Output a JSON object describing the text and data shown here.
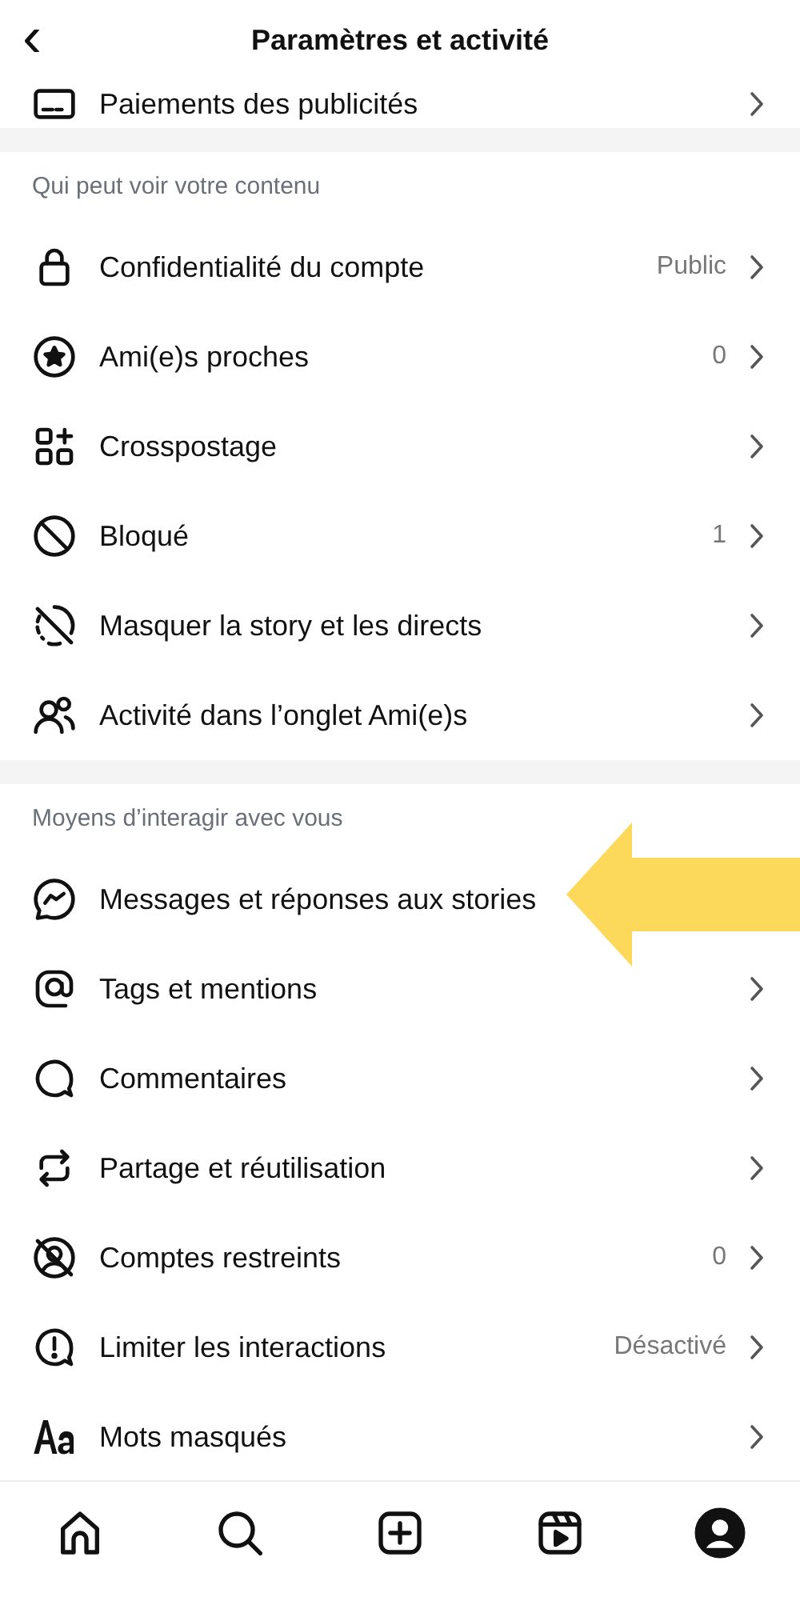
{
  "header": {
    "title": "Paramètres et activité",
    "back": "‹"
  },
  "top_item": {
    "label": "Paiements des publicités",
    "chevron": true
  },
  "sections": [
    {
      "title": "Qui peut voir votre contenu",
      "items": [
        {
          "label": "Confidentialité du compte",
          "value": "Public",
          "chevron": true
        },
        {
          "label": "Ami(e)s proches",
          "value": "0",
          "chevron": true
        },
        {
          "label": "Crosspostage",
          "chevron": true
        },
        {
          "label": "Bloqué",
          "value": "1",
          "chevron": true
        },
        {
          "label": "Masquer la story et les directs",
          "chevron": true
        },
        {
          "label": "Activité dans l’onglet Ami(e)s",
          "chevron": true
        }
      ]
    },
    {
      "title": "Moyens d’interagir avec vous",
      "items": [
        {
          "label": "Messages et réponses aux stories",
          "chevron": false
        },
        {
          "label": "Tags et mentions",
          "chevron": true
        },
        {
          "label": "Commentaires",
          "chevron": true
        },
        {
          "label": "Partage et réutilisation",
          "chevron": true
        },
        {
          "label": "Comptes restreints",
          "value": "0",
          "chevron": true
        },
        {
          "label": "Limiter les interactions",
          "value": "Désactivé",
          "chevron": true
        },
        {
          "label": "Mots masqués",
          "chevron": true
        }
      ]
    }
  ],
  "overlay_arrow": {
    "color": "#fcd95a"
  },
  "tab_bar": [
    {
      "selected": false
    },
    {
      "selected": false
    },
    {
      "selected": false
    },
    {
      "selected": false
    },
    {
      "selected": true
    }
  ]
}
